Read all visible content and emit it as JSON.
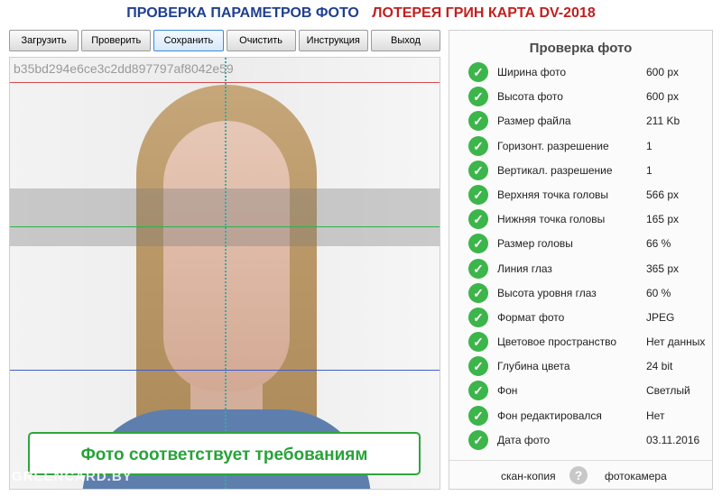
{
  "header": {
    "title_left": "ПРОВЕРКА ПАРАМЕТРОВ ФОТО",
    "title_right": "ЛОТЕРЕЯ ГРИН КАРТА DV-2018",
    "colors": {
      "left": "#1f3f8f",
      "right": "#c0211f"
    }
  },
  "toolbar": {
    "buttons": [
      {
        "label": "Загрузить"
      },
      {
        "label": "Проверить"
      },
      {
        "label": "Сохранить",
        "active": true
      },
      {
        "label": "Очистить"
      },
      {
        "label": "Инструкция"
      },
      {
        "label": "Выход"
      }
    ]
  },
  "photo": {
    "hash": "b35bd294e6ce3c2dd897797af8042e59",
    "status": "Фото соответствует требованиям",
    "watermark": "GREENCARD.BY",
    "guide_colors": {
      "top": "#d44a4a",
      "eyes": "#2fb14a",
      "chin": "#3e5fd1",
      "center": "#3aa8a8"
    }
  },
  "panel": {
    "title": "Проверка фото",
    "rows": [
      {
        "label": "Ширина фото",
        "value": "600 px"
      },
      {
        "label": "Высота фото",
        "value": "600 px"
      },
      {
        "label": "Размер файла",
        "value": "211 Kb"
      },
      {
        "label": "Горизонт. разрешение",
        "value": "1"
      },
      {
        "label": "Вертикал. разрешение",
        "value": "1"
      },
      {
        "label": "Верхняя точка головы",
        "value": "566 px"
      },
      {
        "label": "Нижняя точка головы",
        "value": "165 px"
      },
      {
        "label": "Размер головы",
        "value": "66 %"
      },
      {
        "label": "Линия глаз",
        "value": "365 px"
      },
      {
        "label": "Высота уровня глаз",
        "value": "60 %"
      },
      {
        "label": "Формат фото",
        "value": "JPEG"
      },
      {
        "label": "Цветовое пространство",
        "value": "Нет данных"
      },
      {
        "label": "Глубина цвета",
        "value": "24 bit"
      },
      {
        "label": "Фон",
        "value": "Светлый"
      },
      {
        "label": "Фон редактировался",
        "value": "Нет"
      },
      {
        "label": "Дата фото",
        "value": "03.11.2016"
      }
    ],
    "footer": {
      "left": "скан-копия",
      "help": "?",
      "right": "фотокамера"
    },
    "check_icon": "check-circle-icon",
    "check_color": "#3cb54a"
  }
}
